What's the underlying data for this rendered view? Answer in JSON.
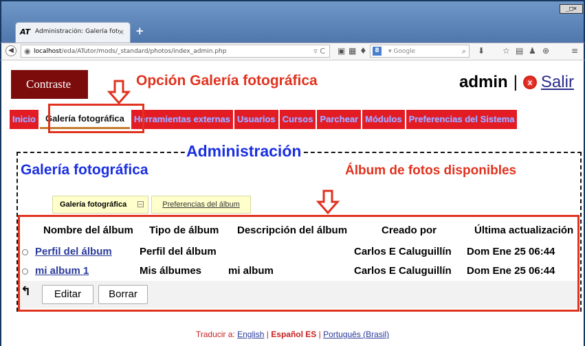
{
  "browser": {
    "tab_logo": "AT",
    "tab_title": "Administración: Galería fotogr…",
    "tab_close": "×",
    "new_tab": "+",
    "window_buttons": "_□×",
    "back": "◀",
    "url_host": "localhost",
    "url_path": "/eda/ATutor/mods/_standard/photos/index_admin.php",
    "url_controls": "▿ C",
    "search_engine_icon": "8",
    "search_placeholder": "▾ Google",
    "search_icon": "⌕",
    "toolbar_icons": [
      "▣",
      "▦",
      "♦",
      "⬇",
      "☆",
      "▤",
      "♟",
      "⊕",
      "≡"
    ]
  },
  "header": {
    "contrast_label": "Contraste",
    "user": "admin",
    "separator": "|",
    "logout_icon": "x",
    "logout_label": "Salir"
  },
  "annotations": {
    "opcion": "Opción Galería fotográfica",
    "administracion": "Administración",
    "albumes": "Álbum de fotos disponibles"
  },
  "nav": {
    "tabs": [
      {
        "label": "Inicio",
        "active": false
      },
      {
        "label": "Galería fotográfica",
        "active": true
      },
      {
        "label": "Herramientas externas",
        "active": false
      },
      {
        "label": "Usuarios",
        "active": false
      },
      {
        "label": "Cursos",
        "active": false
      },
      {
        "label": "Parchear",
        "active": false
      },
      {
        "label": "Módulos",
        "active": false
      },
      {
        "label": "Preferencias del Sistema",
        "active": false
      }
    ]
  },
  "page_title": "Galería fotográfica",
  "subtabs": {
    "active": "Galería fotográfica",
    "active_icon": "−",
    "other": "Preferencias del álbum"
  },
  "table": {
    "headers": [
      "Nombre del álbum",
      "Tipo de álbum",
      "Descripción del álbum",
      "Creado por",
      "Última actualización"
    ],
    "rows": [
      {
        "name": "Perfil del álbum",
        "type": "Perfil del álbum",
        "description": "",
        "created_by": "Carlos E Caluguillín",
        "updated": "Dom Ene 25 06:44"
      },
      {
        "name": "mi album 1",
        "type": "Mis álbumes",
        "description": "mi album",
        "created_by": "Carlos E Caluguillín",
        "updated": "Dom Ene 25 06:44"
      }
    ],
    "up_icon": "↰",
    "edit_label": "Editar",
    "delete_label": "Borrar"
  },
  "footer": {
    "prefix": "Traducir a:",
    "languages": [
      "English",
      "Español ES",
      "Português (Brasil)"
    ],
    "sep": "|"
  },
  "colors": {
    "annotation_red": "#e0321e",
    "annotation_blue": "#1a2fe0",
    "nav_red": "#e31b23",
    "contrast_bg": "#7c0c0c"
  }
}
